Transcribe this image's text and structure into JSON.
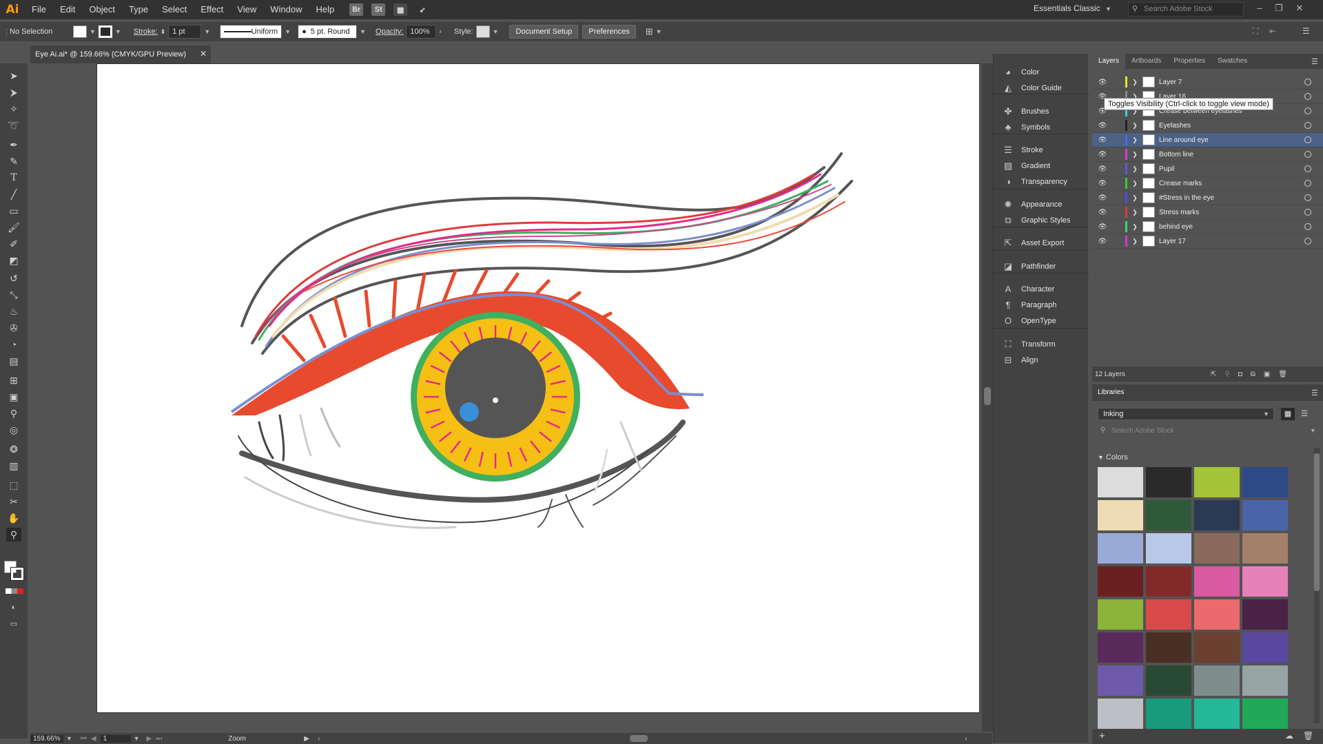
{
  "menubar": {
    "logo": "Ai",
    "items": [
      "File",
      "Edit",
      "Object",
      "Type",
      "Select",
      "Effect",
      "View",
      "Window",
      "Help"
    ],
    "bridge_label": "Br",
    "stock_label": "St",
    "workspace": "Essentials Classic",
    "search_placeholder": "Search Adobe Stock"
  },
  "controlbar": {
    "selection": "No Selection",
    "stroke_label": "Stroke:",
    "stroke_value": "1 pt",
    "profile": "Uniform",
    "brush": "5 pt. Round",
    "opacity_label": "Opacity:",
    "opacity_value": "100%",
    "style_label": "Style:",
    "document_setup": "Document Setup",
    "preferences": "Preferences"
  },
  "document": {
    "tab_title": "Eye Ai.ai* @ 159.66% (CMYK/GPU Preview)"
  },
  "statusbar": {
    "zoom": "159.66%",
    "artboard_number": "1",
    "tool": "Zoom"
  },
  "collapsed_panels": [
    {
      "label": "Color",
      "icon": "color-icon"
    },
    {
      "label": "Color Guide",
      "icon": "color-guide-icon"
    },
    {
      "label": "Brushes",
      "icon": "brushes-icon"
    },
    {
      "label": "Symbols",
      "icon": "symbols-icon"
    },
    {
      "label": "Stroke",
      "icon": "stroke-icon"
    },
    {
      "label": "Gradient",
      "icon": "gradient-icon"
    },
    {
      "label": "Transparency",
      "icon": "transparency-icon"
    },
    {
      "label": "Appearance",
      "icon": "appearance-icon"
    },
    {
      "label": "Graphic Styles",
      "icon": "graphic-styles-icon"
    },
    {
      "label": "Asset Export",
      "icon": "asset-export-icon"
    },
    {
      "label": "Pathfinder",
      "icon": "pathfinder-icon"
    },
    {
      "label": "Character",
      "icon": "character-icon"
    },
    {
      "label": "Paragraph",
      "icon": "paragraph-icon"
    },
    {
      "label": "OpenType",
      "icon": "opentype-icon"
    },
    {
      "label": "Transform",
      "icon": "transform-icon"
    },
    {
      "label": "Align",
      "icon": "align-icon"
    }
  ],
  "layers_panel": {
    "tabs": [
      "Layers",
      "Artboards",
      "Properties",
      "Swatches"
    ],
    "tooltip": "Toggles Visibility (Ctrl-click to toggle view mode)",
    "layers": [
      {
        "name": "Layer 7",
        "color": "#e8e82a",
        "selected": false
      },
      {
        "name": "Layer 16",
        "color": "#8a8a8a",
        "selected": false
      },
      {
        "name": "Crease between eyelashes",
        "color": "#3ad0e0",
        "selected": false
      },
      {
        "name": "Eyelashes",
        "color": "#222222",
        "selected": false
      },
      {
        "name": "Line around eye",
        "color": "#4a6cd8",
        "selected": true
      },
      {
        "name": "Bottom line",
        "color": "#d838d8",
        "selected": false
      },
      {
        "name": "Pupil",
        "color": "#5a5ae0",
        "selected": false
      },
      {
        "name": "Crease marks",
        "color": "#38c838",
        "selected": false
      },
      {
        "name": "#Stress in the eye",
        "color": "#4a4ae8",
        "selected": false
      },
      {
        "name": "Stress marks",
        "color": "#d83a3a",
        "selected": false
      },
      {
        "name": "behind eye",
        "color": "#38d878",
        "selected": false
      },
      {
        "name": "Layer 17",
        "color": "#d838c8",
        "selected": false
      }
    ],
    "count": "12 Layers"
  },
  "libraries": {
    "title": "Libraries",
    "selected_library": "Inking",
    "search_placeholder": "Search Adobe Stock",
    "colors_heading": "Colors",
    "swatches": [
      "#dcdcdc",
      "#2a2a2a",
      "#a4c43a",
      "#2e4a86",
      "#eedcb4",
      "#2e5a3a",
      "#2a3a52",
      "#4a64a8",
      "#9aaad6",
      "#b8c8e8",
      "#8a6a5a",
      "#a4806a",
      "#6a2020",
      "#822a2a",
      "#d85aa0",
      "#e482b8",
      "#8cb43a",
      "#d84a4a",
      "#ec6a6e",
      "#4a2248",
      "#5a2a5a",
      "#4a3024",
      "#6a4030",
      "#5a48a0",
      "#6e5aaa",
      "#284a32",
      "#7e8c8c",
      "#96a4a4",
      "#bcc0c4",
      "#189a7c",
      "#24b896",
      "#20aa58"
    ]
  }
}
